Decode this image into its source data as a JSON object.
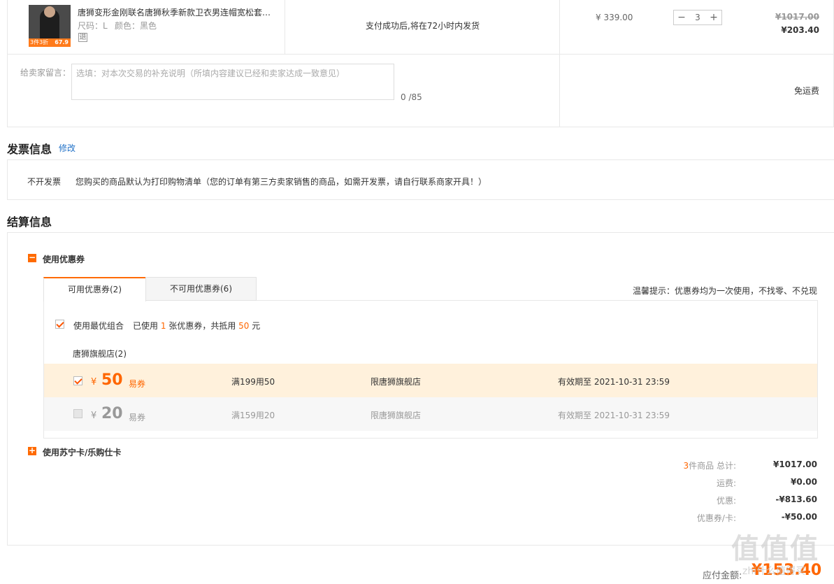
{
  "product": {
    "thumb_badge": "67.9",
    "thumb_badge_prefix": "3件3折",
    "title": "唐狮变形金刚联名唐狮秋季新款卫衣男连帽宽松套…",
    "size_label": "尺码：L",
    "color_label": "颜色：黑色",
    "return_icon": "退",
    "shipping_note": "支付成功后,将在72小时内发货",
    "unit_price": "¥ 339.00",
    "quantity": "3",
    "minus": "−",
    "plus": "+",
    "original_total": "¥1017.00",
    "total": "¥203.40"
  },
  "message": {
    "label": "给卖家留言：",
    "placeholder": "选填：对本次交易的补充说明（所填内容建议已经和卖家达成一致意见）",
    "counter": "0 /85",
    "shipping_fee": "免运费"
  },
  "invoice": {
    "title": "发票信息",
    "edit_link": "修改",
    "type": "不开发票",
    "note": "您购买的商品默认为打印购物清单（您的订单有第三方卖家销售的商品，如需开发票，请自行联系商家开具！）"
  },
  "settlement": {
    "title": "结算信息",
    "coupon_toggle": "使用优惠券",
    "tabs": [
      "可用优惠券(2)",
      "不可用优惠券(6)"
    ],
    "tip": "温馨提示：优惠券均为一次使用，不找零、不兑现",
    "best_combo_label": "使用最优组合",
    "used_prefix": "已使用",
    "used_count": "1",
    "used_mid": "张优惠券，共抵用",
    "used_amount": "50",
    "used_suffix": "元",
    "store_group": "唐狮旗舰店(2)",
    "coupons": [
      {
        "currency": "¥",
        "amount": "50",
        "kind": "易券",
        "condition": "满199用50",
        "scope": "限唐狮旗舰店",
        "expiry": "有效期至 2021-10-31 23:59"
      },
      {
        "currency": "¥",
        "amount": "20",
        "kind": "易券",
        "condition": "满159用20",
        "scope": "限唐狮旗舰店",
        "expiry": "有效期至 2021-10-31 23:59"
      }
    ],
    "card_toggle": "使用苏宁卡/乐购仕卡"
  },
  "summary": {
    "count_prefix": "3",
    "count_label": "件商品 总计:",
    "total": "¥1017.00",
    "shipping_label": "运费:",
    "shipping": "¥0.00",
    "discount_label": "优惠:",
    "discount": "-¥813.60",
    "coupon_label": "优惠券/卡:",
    "coupon": "-¥50.00",
    "payable_label": "应付金额:",
    "payable": "¥153.40"
  },
  "watermark": {
    "text": "值值值",
    "sub": "zhi什么值得买"
  },
  "colors": {
    "accent": "#ff6600",
    "highlight_row": "#fff1dc",
    "disabled_row": "#f7f7f7"
  }
}
